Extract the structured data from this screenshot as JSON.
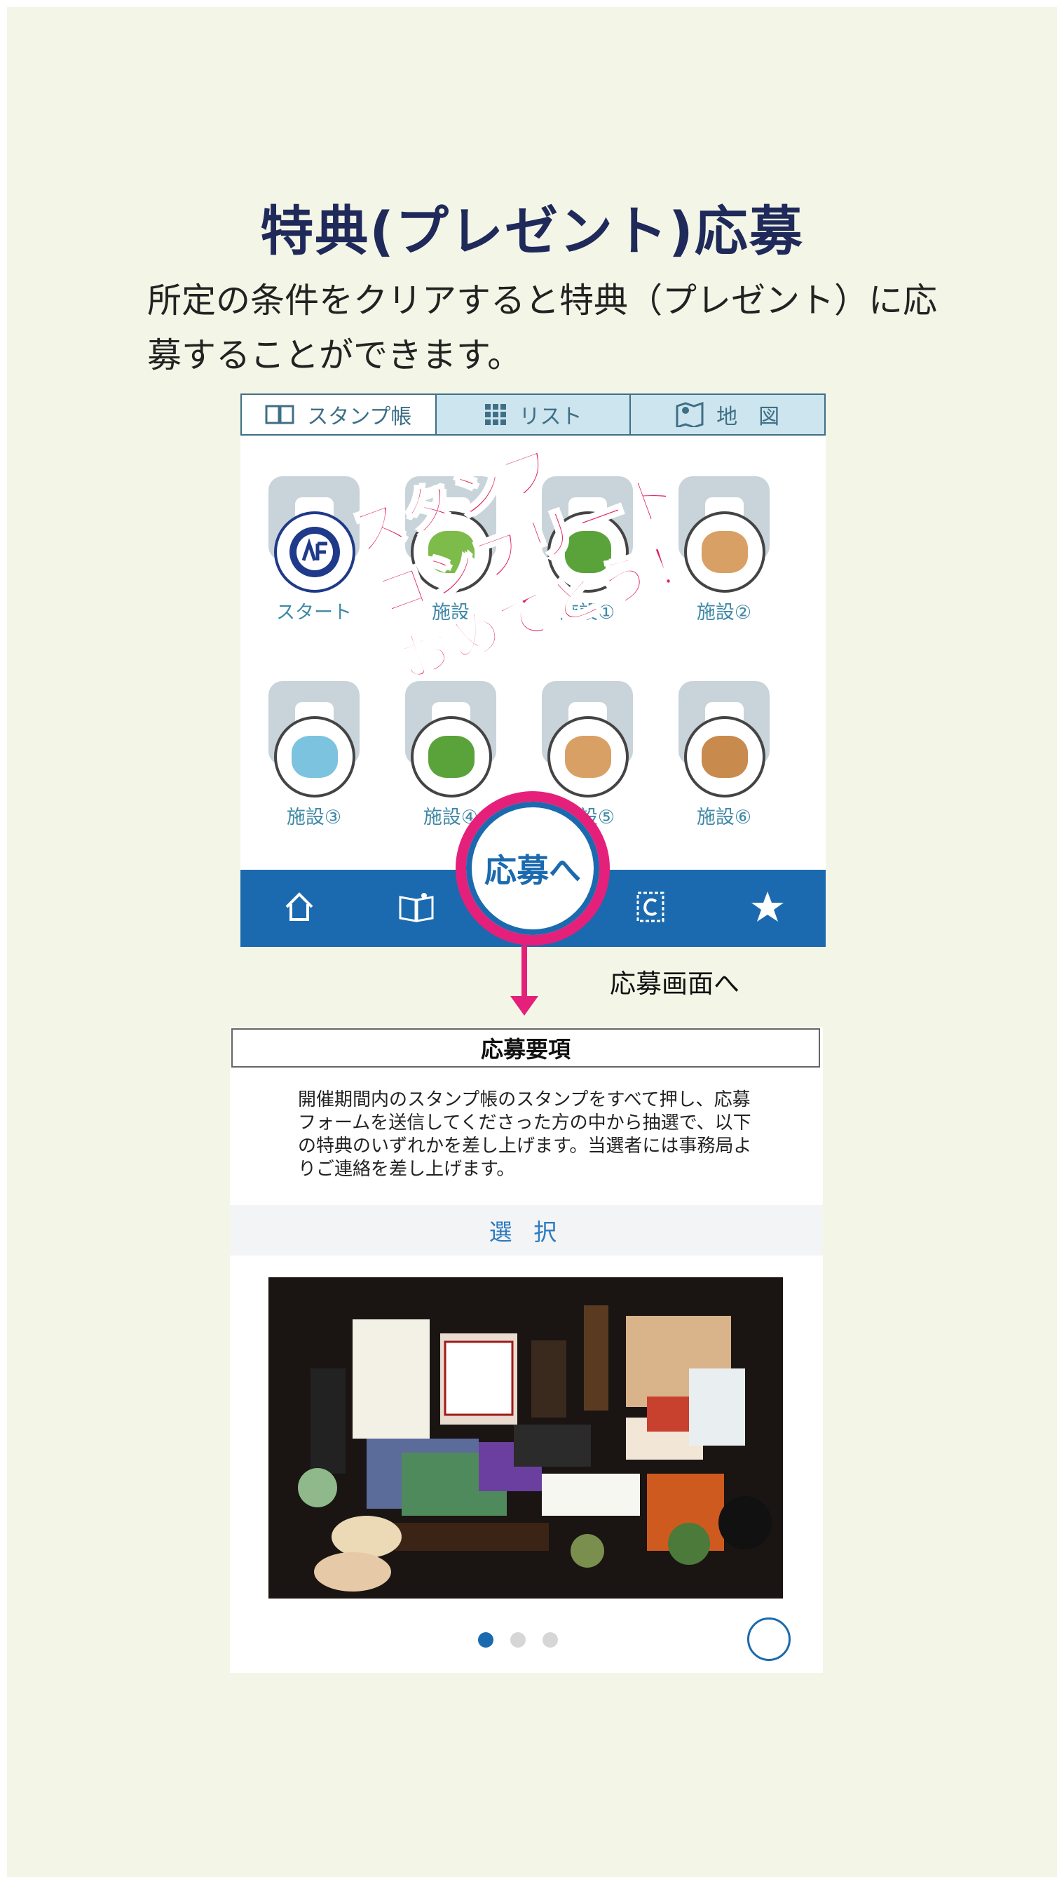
{
  "page": {
    "heading": "特典(プレゼント)応募",
    "intro": "所定の条件をクリアすると特典（プレゼント）に応募することができます。"
  },
  "app_top": {
    "tabs": [
      {
        "label": "スタンプ帳",
        "icon": "book-icon"
      },
      {
        "label": "リスト",
        "icon": "grid-icon"
      },
      {
        "label": "地　図",
        "icon": "map-pin-icon"
      }
    ],
    "stamps": [
      {
        "label": "スタート"
      },
      {
        "label": "施設"
      },
      {
        "label": "施設①"
      },
      {
        "label": "施設②"
      },
      {
        "label": "施設③"
      },
      {
        "label": "施設④"
      },
      {
        "label": "施設⑤"
      },
      {
        "label": "施設⑥"
      }
    ],
    "overlay_lines": [
      "スタンプ",
      "コンプリート",
      "おめでとう！"
    ],
    "apply_button": "応募へ",
    "bottom_nav": [
      {
        "icon": "home-icon"
      },
      {
        "icon": "guide-book-icon"
      },
      {
        "icon": "apply-icon"
      },
      {
        "icon": "coupon-icon"
      },
      {
        "icon": "star-icon"
      }
    ],
    "colors": {
      "accent": "#1b6aaf",
      "highlight": "#e5207a",
      "tab_border": "#3f6f86"
    }
  },
  "annotation": {
    "to_apply_screen": "応募画面へ"
  },
  "app_apply": {
    "title": "応募要項",
    "body": "開催期間内のスタンプ帳のスタンプをすべて押し、応募フォームを送信してくださった方の中から抽選で、以下の特典のいずれかを差し上げます。当選者には事務局よりご連絡を差し上げます。",
    "select_label": "選 択",
    "carousel": {
      "active_index": 0,
      "count": 3
    }
  }
}
